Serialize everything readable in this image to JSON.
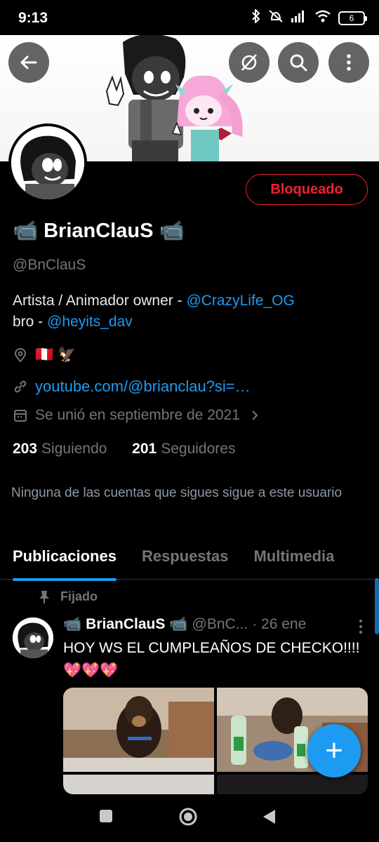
{
  "status_bar": {
    "time": "9:13",
    "battery": "6"
  },
  "profile": {
    "blocked_label": "Bloqueado",
    "name": "BrianClauS",
    "name_emoji": "📹",
    "handle": "@BnClauS",
    "bio_text_1": "Artista / Animador  owner - ",
    "bio_link_1": "@CrazyLife_OG",
    "bio_text_2": "bro - ",
    "bio_link_2": "@heyits_dav",
    "location": "🇵🇪 🦅",
    "website": "youtube.com/@brianclau?si=…",
    "joined": "Se unió en septiembre de 2021",
    "following_count": "203",
    "following_label": "Siguiendo",
    "followers_count": "201",
    "followers_label": "Seguidores",
    "not_followed_text": "Ninguna de las cuentas que sigues sigue a este usuario"
  },
  "tabs": [
    {
      "label": "Publicaciones",
      "active": true
    },
    {
      "label": "Respuestas",
      "active": false
    },
    {
      "label": "Multimedia",
      "active": false
    }
  ],
  "pinned_tweet": {
    "pinned_label": "Fijado",
    "author_name": "BrianClauS",
    "name_emoji": "📹",
    "author_handle": "@BnC...",
    "date": "· 26 ene",
    "text": "HOY WS EL CUMPLEAÑOS DE CHECKO!!!! 💖💖💖"
  },
  "fab_label": "+",
  "colors": {
    "accent": "#1d9bf0",
    "blocked": "#f4212e",
    "background": "#000000",
    "secondary_text": "#71767b"
  }
}
